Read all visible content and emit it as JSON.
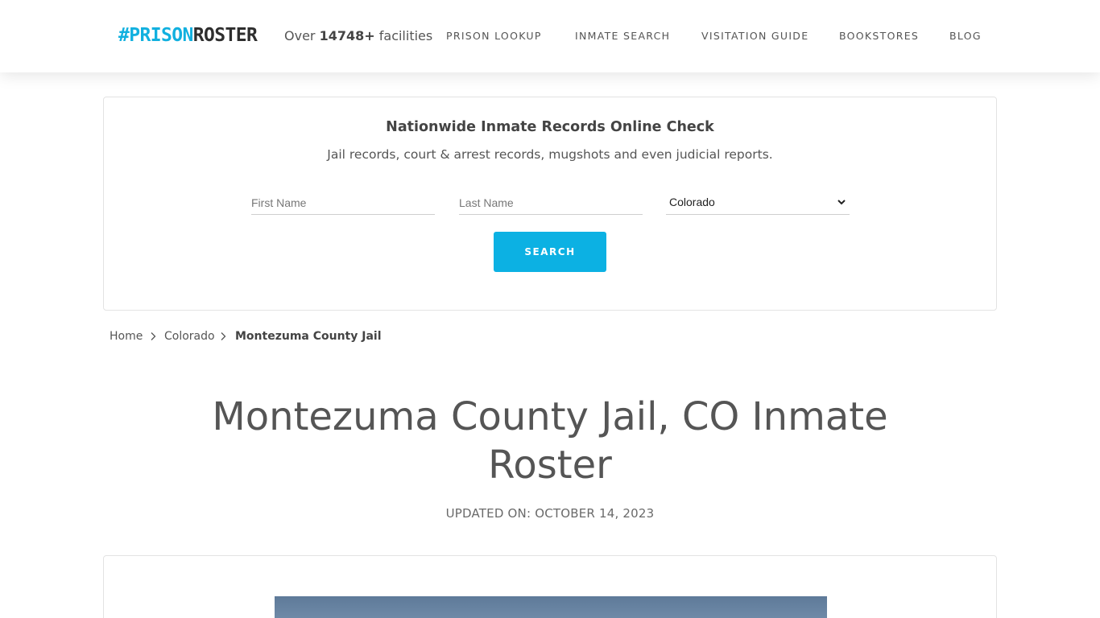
{
  "header": {
    "logo": {
      "hash": "#",
      "prison": "PRISON",
      "roster": "ROSTER"
    },
    "facilities": {
      "prefix": "Over",
      "count": "14748+",
      "suffix": "facilities"
    },
    "nav": [
      {
        "label": "PRISON LOOKUP"
      },
      {
        "label": "INMATE SEARCH"
      },
      {
        "label": "VISITATION GUIDE"
      },
      {
        "label": "BOOKSTORES"
      },
      {
        "label": "BLOG"
      }
    ]
  },
  "search": {
    "title": "Nationwide Inmate Records Online Check",
    "subtitle": "Jail records, court & arrest records, mugshots and even judicial reports.",
    "first_name_placeholder": "First Name",
    "last_name_placeholder": "Last Name",
    "state_selected": "Colorado",
    "button_label": "SEARCH"
  },
  "breadcrumb": {
    "home": "Home",
    "state": "Colorado",
    "current": "Montezuma County Jail"
  },
  "page": {
    "title": "Montezuma County Jail, CO Inmate Roster",
    "updated": "UPDATED ON: OCTOBER 14, 2023"
  },
  "colors": {
    "brand": "#11b0df",
    "button": "#0cb1e3",
    "text": "#555555"
  },
  "icons": [
    "chevron-right-icon",
    "chevron-down-icon"
  ]
}
